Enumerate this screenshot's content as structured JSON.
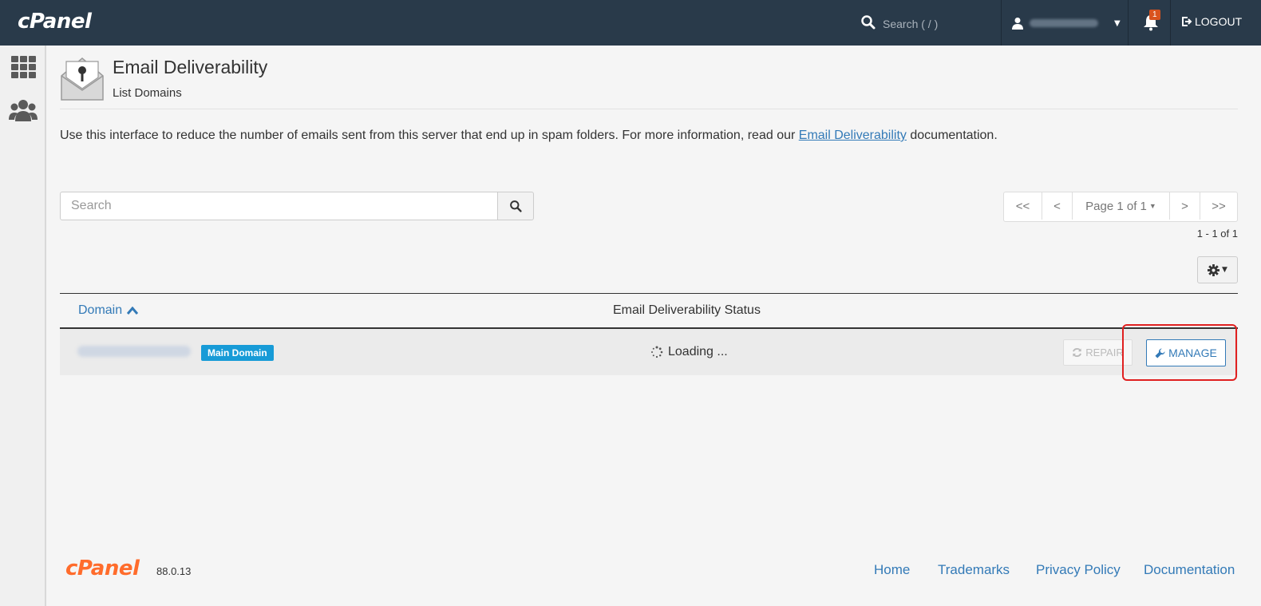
{
  "topbar": {
    "logo": "cPanel",
    "search_placeholder": "Search ( / )",
    "notification_count": "1",
    "logout_label": "LOGOUT"
  },
  "page": {
    "title": "Email Deliverability",
    "subtitle": "List Domains",
    "intro_before": "Use this interface to reduce the number of emails sent from this server that end up in spam folders. For more information, read our ",
    "intro_link": "Email Deliverability",
    "intro_after": " documentation."
  },
  "search": {
    "placeholder": "Search"
  },
  "pagination": {
    "first": "<<",
    "prev": "<",
    "page_label": "Page 1 of 1",
    "next": ">",
    "last": ">>",
    "count": "1 - 1 of 1"
  },
  "table": {
    "columns": [
      "Domain",
      "Email Deliverability Status"
    ],
    "rows": [
      {
        "badge": "Main Domain",
        "status": "Loading ...",
        "repair_label": "REPAIR",
        "manage_label": "MANAGE"
      }
    ]
  },
  "footer": {
    "logo": "cPanel",
    "version": "88.0.13",
    "links": [
      "Home",
      "Trademarks",
      "Privacy Policy",
      "Documentation"
    ]
  },
  "colors": {
    "topbar": "#293a4a",
    "link": "#337ab7",
    "badge": "#179bd7",
    "brand_orange": "#ff6c2c",
    "highlight": "#e02020"
  }
}
